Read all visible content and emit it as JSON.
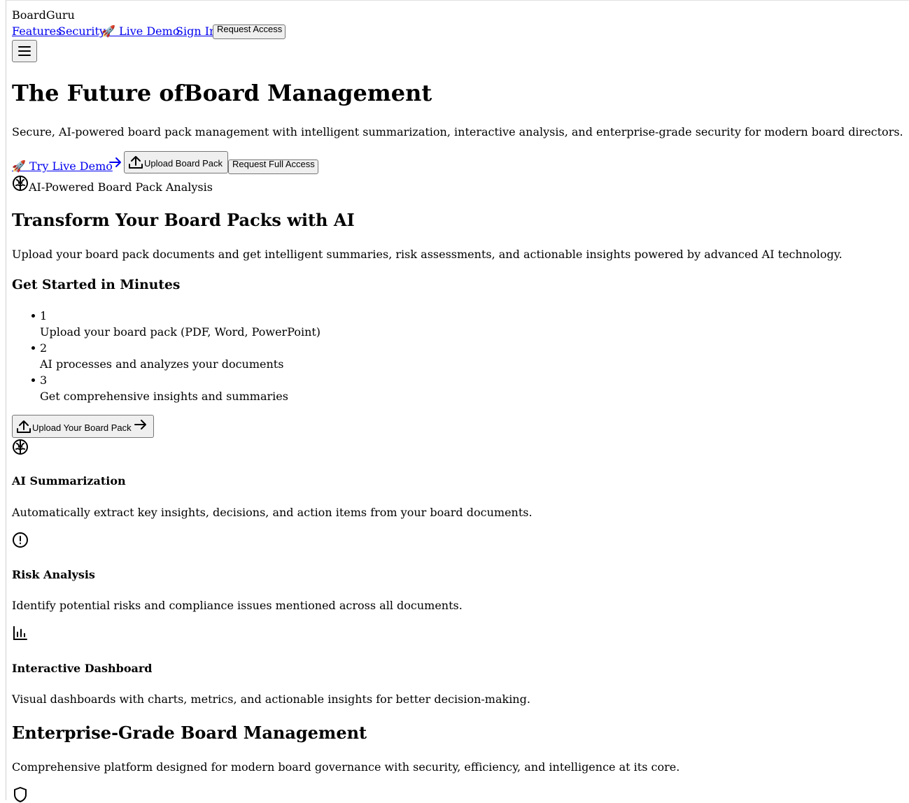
{
  "brand": "BoardGuru",
  "nav": {
    "features": "Features",
    "security": "Security",
    "live_demo": "🚀 Live Demo",
    "sign_in": "Sign In",
    "request_access": "Request Access"
  },
  "hero": {
    "title": "The Future ofBoard Management",
    "subtitle": "Secure, AI-powered board pack management with intelligent summarization, interactive analysis, and enterprise-grade security for modern board directors.",
    "try_demo": "🚀 Try Live Demo",
    "upload": "Upload Board Pack",
    "request_full": "Request Full Access"
  },
  "ai_section": {
    "badge": "AI-Powered Board Pack Analysis",
    "title": "Transform Your Board Packs with AI",
    "description": "Upload your board pack documents and get intelligent summaries, risk assessments, and actionable insights powered by advanced AI technology.",
    "steps_title": "Get Started in Minutes",
    "steps": [
      {
        "num": "1",
        "text": "Upload your board pack (PDF, Word, PowerPoint)"
      },
      {
        "num": "2",
        "text": "AI processes and analyzes your documents"
      },
      {
        "num": "3",
        "text": "Get comprehensive insights and summaries"
      }
    ],
    "upload_button": "Upload Your Board Pack"
  },
  "features": [
    {
      "icon": "brain-icon",
      "title": "AI Summarization",
      "text": "Automatically extract key insights, decisions, and action items from your board documents."
    },
    {
      "icon": "alert-circle-icon",
      "title": "Risk Analysis",
      "text": "Identify potential risks and compliance issues mentioned across all documents."
    },
    {
      "icon": "bar-chart-icon",
      "title": "Interactive Dashboard",
      "text": "Visual dashboards with charts, metrics, and actionable insights for better decision-making."
    }
  ],
  "enterprise": {
    "title": "Enterprise-Grade Board Management",
    "description": "Comprehensive platform designed for modern board governance with security, efficiency, and intelligence at its core.",
    "icon": "shield-icon"
  }
}
